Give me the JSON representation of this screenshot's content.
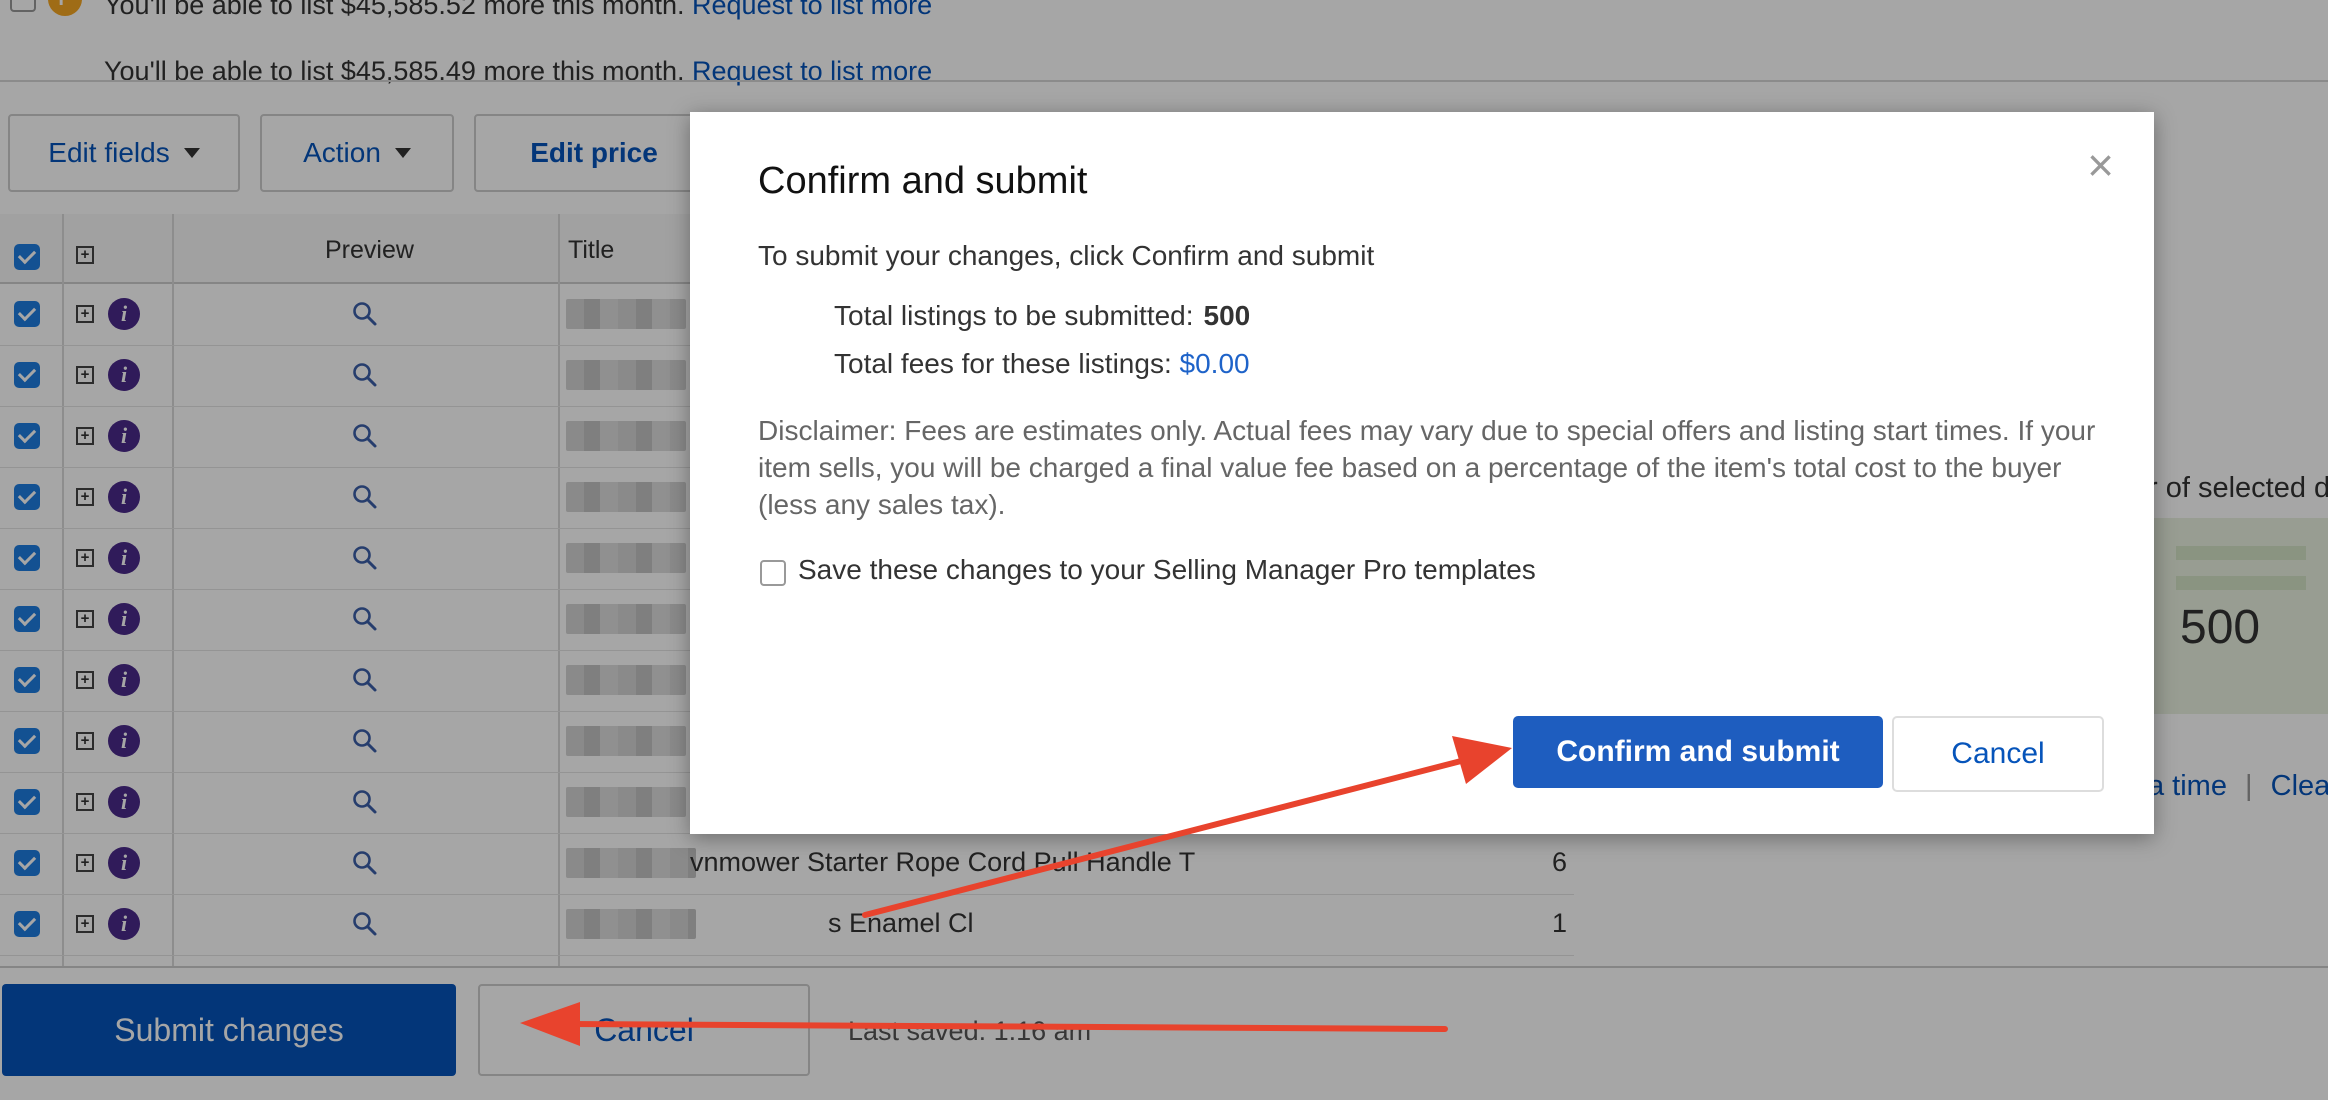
{
  "notices": [
    {
      "prefix": "You'll be able to list $45,585.52 more this month. ",
      "link": "Request to list more"
    },
    {
      "prefix": "You'll be able to list $45,585.49 more this month. ",
      "link": "Request to list more"
    }
  ],
  "toolbar": {
    "edit_fields": "Edit fields",
    "action": "Action",
    "edit_price": "Edit price"
  },
  "grid": {
    "headers": {
      "preview": "Preview",
      "title": "Title"
    },
    "visible_titles": [
      {
        "text": "vnmower Starter Rope Cord Pull Handle T",
        "count": "6"
      },
      {
        "text": "s Enamel Cl",
        "count": "1"
      }
    ]
  },
  "right_panel": {
    "selected_fragment": "r of selected d",
    "count": "500",
    "link_a_time": "a time",
    "link_clear": "Clear a"
  },
  "bottom": {
    "submit_changes": "Submit changes",
    "cancel": "Cancel",
    "last_saved": "Last saved: 1:16 am"
  },
  "modal": {
    "title": "Confirm and submit",
    "close": "×",
    "intro": "To submit your changes, click  Confirm and submit",
    "total_listings_label": "Total listings to be submitted:",
    "total_listings_value": "500",
    "total_fees_label": "Total fees for these listings:",
    "total_fees_value": "$0.00",
    "disclaimer": "Disclaimer: Fees are estimates only. Actual fees may vary due to special offers and listing start times. If your item sells, you will be charged a final value fee based on a percentage of the item's total cost to the buyer (less any sales tax).",
    "save_templates_label": "Save these changes to your Selling Manager Pro templates",
    "confirm_button": "Confirm and submit",
    "cancel_button": "Cancel"
  },
  "colors": {
    "accent": "#0654ba",
    "confirm": "#1e5dbf",
    "arrow": "#e8432d"
  }
}
